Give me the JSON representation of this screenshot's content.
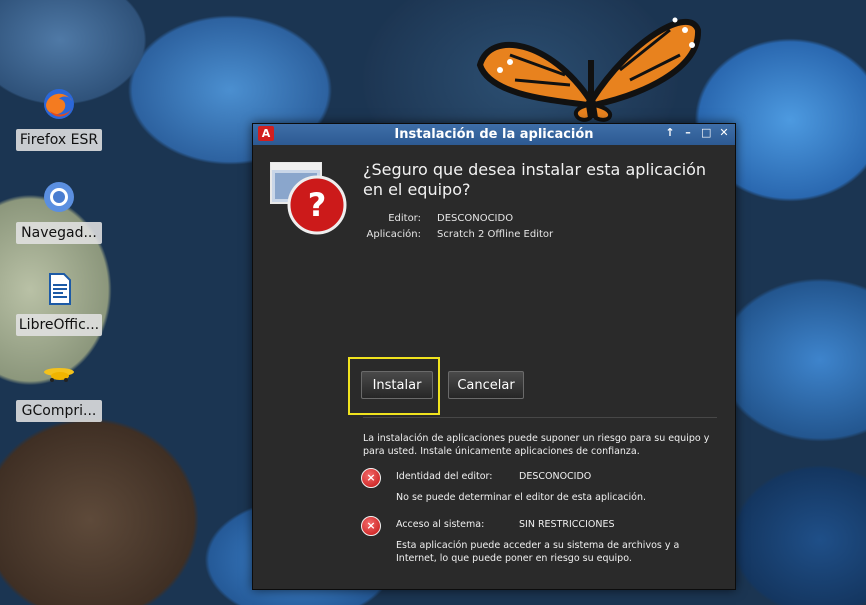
{
  "desktop": {
    "icons": [
      {
        "label": "Firefox ESR",
        "icon": "firefox-icon"
      },
      {
        "label": "Navegad...",
        "icon": "chromium-icon"
      },
      {
        "label": "LibreOffic...",
        "icon": "libreoffice-writer-icon"
      },
      {
        "label": "GCompri...",
        "icon": "gcompris-icon"
      }
    ]
  },
  "dialog": {
    "title": "Instalación de la aplicación",
    "app_icon_glyph": "A",
    "question": "¿Seguro que desea instalar esta aplicación en el equipo?",
    "editor_label": "Editor:",
    "editor_value": "DESCONOCIDO",
    "application_label": "Aplicación:",
    "application_value": "Scratch 2 Offline Editor",
    "install_button": "Instalar",
    "cancel_button": "Cancelar",
    "risk_warning": "La instalación de aplicaciones puede suponer un riesgo para su equipo y para usted. Instale únicamente aplicaciones de confianza.",
    "identity_label": "Identidad del editor:",
    "identity_value": "DESCONOCIDO",
    "identity_desc": "No se puede determinar el editor de esta aplicación.",
    "access_label": "Acceso al sistema:",
    "access_value": "SIN RESTRICCIONES",
    "access_desc": "Esta aplicación puede acceder a su sistema de archivos y a Internet, lo que puede poner en riesgo su equipo.",
    "x_glyph": "×",
    "question_glyph": "?"
  },
  "colors": {
    "titlebar": "#3462a0",
    "dialog_bg": "#2a2a2a",
    "focus": "#f0e31e",
    "warning_red": "#d01a1a"
  }
}
